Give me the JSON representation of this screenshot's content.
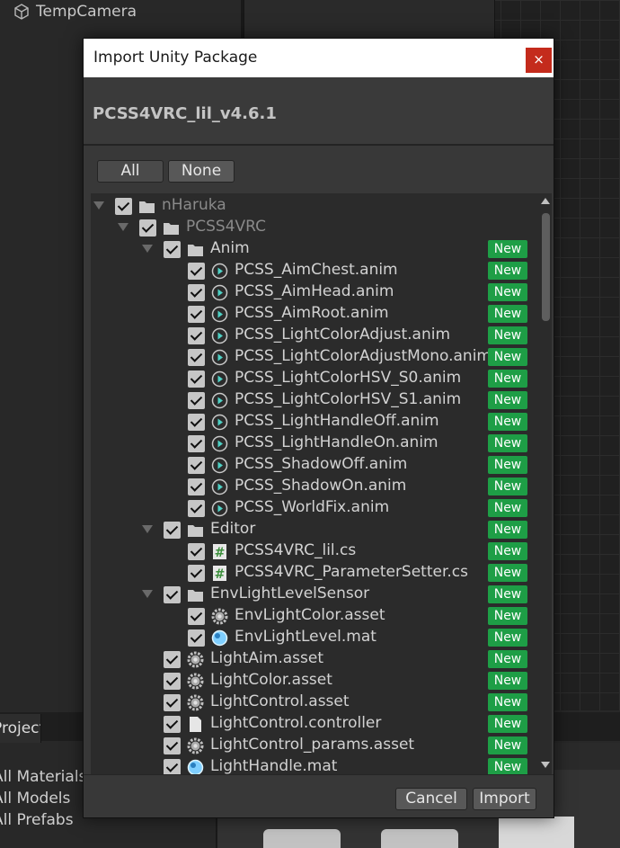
{
  "background": {
    "hierarchy_item": "TempCamera",
    "project_tab": "Project",
    "favorites": [
      "All Materials",
      "All Models",
      "All Prefabs"
    ]
  },
  "dialog": {
    "title": "Import Unity Package",
    "close_glyph": "×",
    "package_name": "PCSS4VRC_lil_v4.6.1",
    "all_button": "All",
    "none_button": "None",
    "cancel_button": "Cancel",
    "import_button": "Import",
    "new_badge": "New",
    "tree": [
      {
        "label": "nHaruka",
        "depth": 0,
        "icon": "folder-icon",
        "expandable": true,
        "checked": true,
        "is_new": false,
        "dim": true
      },
      {
        "label": "PCSS4VRC",
        "depth": 1,
        "icon": "folder-icon",
        "expandable": true,
        "checked": true,
        "is_new": false,
        "dim": true
      },
      {
        "label": "Anim",
        "depth": 2,
        "icon": "folder-icon",
        "expandable": true,
        "checked": true,
        "is_new": true,
        "dim": false
      },
      {
        "label": "PCSS_AimChest.anim",
        "depth": 3,
        "icon": "animation-clip-icon",
        "checked": true,
        "is_new": true
      },
      {
        "label": "PCSS_AimHead.anim",
        "depth": 3,
        "icon": "animation-clip-icon",
        "checked": true,
        "is_new": true
      },
      {
        "label": "PCSS_AimRoot.anim",
        "depth": 3,
        "icon": "animation-clip-icon",
        "checked": true,
        "is_new": true
      },
      {
        "label": "PCSS_LightColorAdjust.anim",
        "depth": 3,
        "icon": "animation-clip-icon",
        "checked": true,
        "is_new": true
      },
      {
        "label": "PCSS_LightColorAdjustMono.anim",
        "depth": 3,
        "icon": "animation-clip-icon",
        "checked": true,
        "is_new": true
      },
      {
        "label": "PCSS_LightColorHSV_S0.anim",
        "depth": 3,
        "icon": "animation-clip-icon",
        "checked": true,
        "is_new": true
      },
      {
        "label": "PCSS_LightColorHSV_S1.anim",
        "depth": 3,
        "icon": "animation-clip-icon",
        "checked": true,
        "is_new": true
      },
      {
        "label": "PCSS_LightHandleOff.anim",
        "depth": 3,
        "icon": "animation-clip-icon",
        "checked": true,
        "is_new": true
      },
      {
        "label": "PCSS_LightHandleOn.anim",
        "depth": 3,
        "icon": "animation-clip-icon",
        "checked": true,
        "is_new": true
      },
      {
        "label": "PCSS_ShadowOff.anim",
        "depth": 3,
        "icon": "animation-clip-icon",
        "checked": true,
        "is_new": true
      },
      {
        "label": "PCSS_ShadowOn.anim",
        "depth": 3,
        "icon": "animation-clip-icon",
        "checked": true,
        "is_new": true
      },
      {
        "label": "PCSS_WorldFix.anim",
        "depth": 3,
        "icon": "animation-clip-icon",
        "checked": true,
        "is_new": true
      },
      {
        "label": "Editor",
        "depth": 2,
        "icon": "folder-icon",
        "expandable": true,
        "checked": true,
        "is_new": true
      },
      {
        "label": "PCSS4VRC_lil.cs",
        "depth": 3,
        "icon": "csharp-script-icon",
        "checked": true,
        "is_new": true
      },
      {
        "label": "PCSS4VRC_ParameterSetter.cs",
        "depth": 3,
        "icon": "csharp-script-icon",
        "checked": true,
        "is_new": true
      },
      {
        "label": "EnvLightLevelSensor",
        "depth": 2,
        "icon": "folder-icon",
        "expandable": true,
        "checked": true,
        "is_new": true
      },
      {
        "label": "EnvLightColor.asset",
        "depth": 3,
        "icon": "gear-icon",
        "checked": true,
        "is_new": true
      },
      {
        "label": "EnvLightLevel.mat",
        "depth": 3,
        "icon": "material-sphere-icon",
        "checked": true,
        "is_new": true
      },
      {
        "label": "LightAim.asset",
        "depth": 2,
        "icon": "gear-icon",
        "checked": true,
        "is_new": true
      },
      {
        "label": "LightColor.asset",
        "depth": 2,
        "icon": "gear-icon",
        "checked": true,
        "is_new": true
      },
      {
        "label": "LightControl.asset",
        "depth": 2,
        "icon": "gear-icon",
        "checked": true,
        "is_new": true
      },
      {
        "label": "LightControl.controller",
        "depth": 2,
        "icon": "document-icon",
        "checked": true,
        "is_new": true
      },
      {
        "label": "LightControl_params.asset",
        "depth": 2,
        "icon": "gear-icon",
        "checked": true,
        "is_new": true
      },
      {
        "label": "LightHandle.mat",
        "depth": 2,
        "icon": "material-sphere-icon",
        "checked": true,
        "is_new": true
      }
    ]
  },
  "colors": {
    "new_badge": "#1e9e46",
    "close_button": "#c42b1c",
    "dialog_bg": "#383838"
  }
}
